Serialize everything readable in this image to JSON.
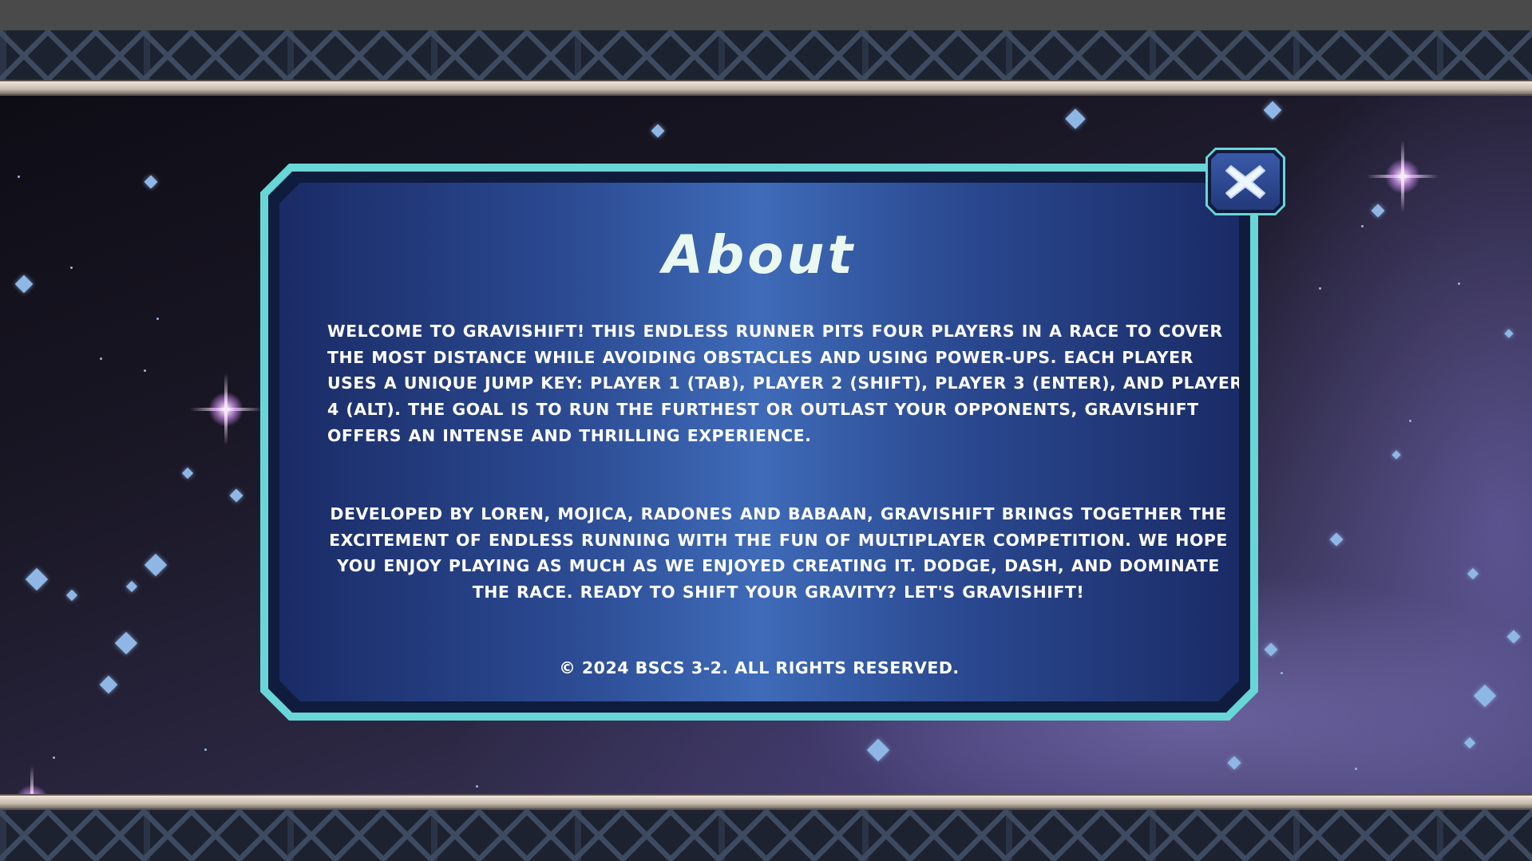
{
  "dialog": {
    "title": "About",
    "paragraph_1": "Welcome to Gravishift! This endless runner pits four players in a race to cover the most distance while avoiding obstacles and using power-ups. Each player uses a unique jump key: Player 1 (Tab), Player 2 (Shift), Player 3 (Enter), and Player 4 (Alt).  The goal is to run the furthest or outlast your opponents, Gravishift offers an intense and thrilling experience.",
    "paragraph_2": "Developed by Loren, Mojica, Radones and Babaan, Gravishift brings together the excitement of endless running with the fun of multiplayer competition. We hope you enjoy playing as much as we enjoyed creating it. Dodge, dash, and dominate the race. Ready to shift your gravity? Let's Gravishift!",
    "copyright": "© 2024 BSCS 3-2. All rights reserved.",
    "close_icon": "close-x-icon"
  },
  "colors": {
    "frame": "#68d6d6",
    "panel_center": "#3f6bb8",
    "panel_edge": "#1a2b66",
    "title": "#eaf8f2",
    "text": "#ffffff"
  }
}
